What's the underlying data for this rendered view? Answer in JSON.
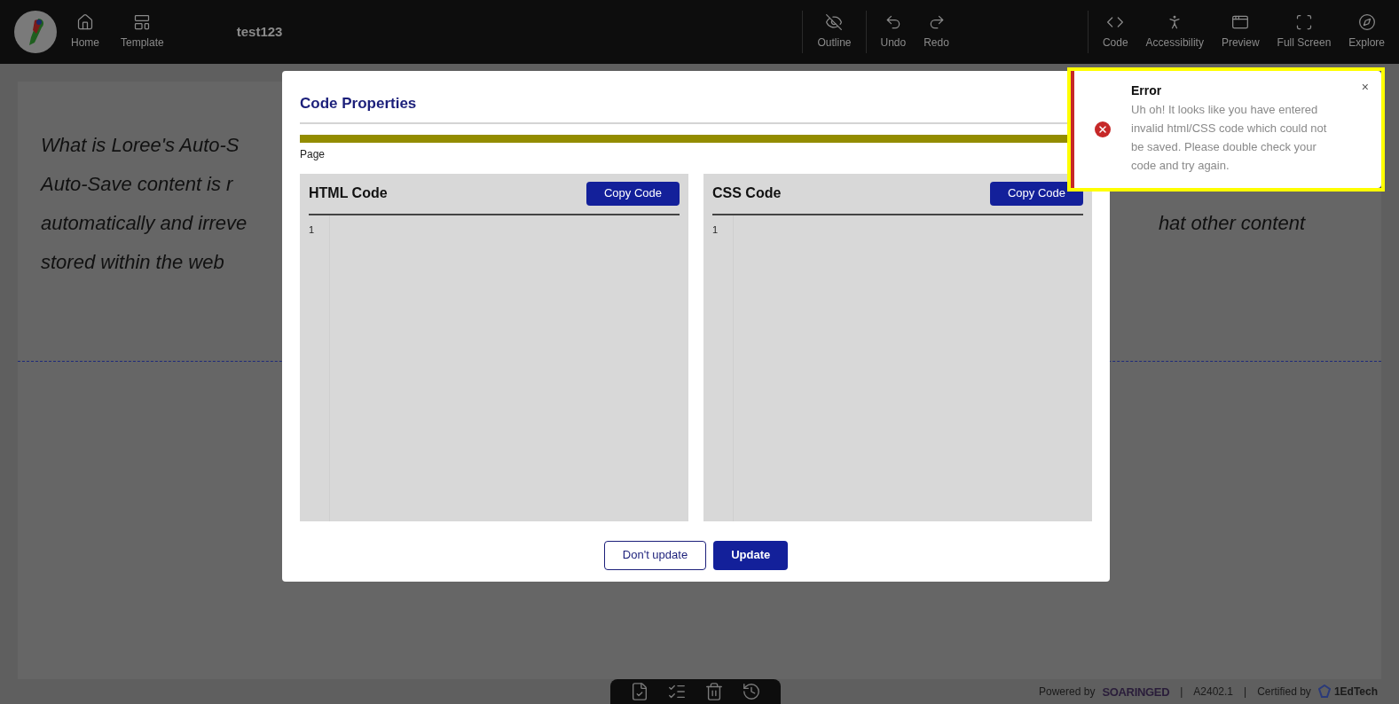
{
  "header": {
    "nav": [
      {
        "label": "Home"
      },
      {
        "label": "Template"
      }
    ],
    "doc_title": "test123",
    "tool_groups": [
      [
        {
          "label": "Outline"
        }
      ],
      [
        {
          "label": "Undo"
        },
        {
          "label": "Redo"
        }
      ],
      [
        {
          "label": "Code"
        },
        {
          "label": "Accessibility"
        },
        {
          "label": "Preview"
        },
        {
          "label": "Full Screen"
        },
        {
          "label": "Explore"
        }
      ]
    ]
  },
  "page": {
    "left_lines": [
      "What is Loree's Auto-S",
      "Auto-Save content is r",
      "automatically and irreve",
      "stored within the web"
    ],
    "right_lines": [
      "hat other content"
    ]
  },
  "modal": {
    "title": "Code Properties",
    "section_label": "Page",
    "panels": [
      {
        "title": "HTML Code",
        "button": "Copy Code",
        "line_numbers": [
          "1"
        ]
      },
      {
        "title": "CSS Code",
        "button": "Copy Code",
        "line_numbers": [
          "1"
        ]
      }
    ],
    "buttons": [
      {
        "label": "Don't update",
        "kind": "secondary"
      },
      {
        "label": "Update",
        "kind": "primary"
      }
    ]
  },
  "toast": {
    "title": "Error",
    "message": "Uh oh! It looks like you have entered invalid html/CSS code which could not be saved. Please double check your code and try again.",
    "close": "×"
  },
  "footer": [
    {
      "kind": "text",
      "text": "Powered by"
    },
    {
      "kind": "brand",
      "text": "SOARINGED"
    },
    {
      "kind": "sep",
      "text": "|"
    },
    {
      "kind": "text",
      "text": "A2402.1"
    },
    {
      "kind": "sep",
      "text": "|"
    },
    {
      "kind": "text",
      "text": "Certified by"
    },
    {
      "kind": "logo",
      "text": "1EdTech"
    }
  ]
}
